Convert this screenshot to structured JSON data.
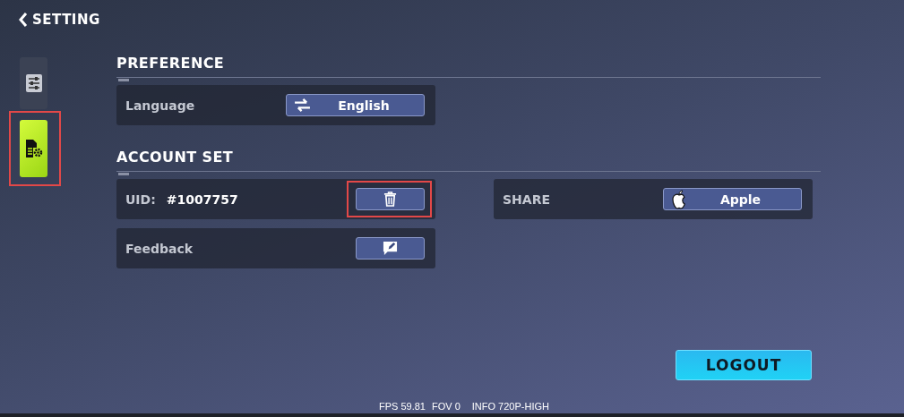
{
  "header": {
    "title": "SETTING"
  },
  "sidebar": {
    "tabs": [
      {
        "kind": "sliders",
        "selected": false,
        "highlighted": false
      },
      {
        "kind": "document-gear",
        "selected": true,
        "highlighted": true
      }
    ]
  },
  "preference": {
    "title": "PREFERENCE",
    "rows": [
      {
        "kind": "select",
        "label": "Language",
        "value": "English",
        "highlighted": false
      }
    ]
  },
  "account_set": {
    "title": "ACCOUNT SET",
    "left": [
      {
        "kind": "uid",
        "label": "UID:",
        "value": "#1007757",
        "highlighted": true
      },
      {
        "kind": "feedback",
        "label": "Feedback",
        "highlighted": false
      }
    ],
    "right": [
      {
        "kind": "share",
        "label": "SHARE",
        "value": "Apple",
        "highlighted": false
      }
    ]
  },
  "logout": {
    "label": "LOGOUT"
  },
  "status_bar": {
    "fps": "FPS 59.81",
    "fov": "FOV 0",
    "info": "INFO 720P-HIGH"
  }
}
